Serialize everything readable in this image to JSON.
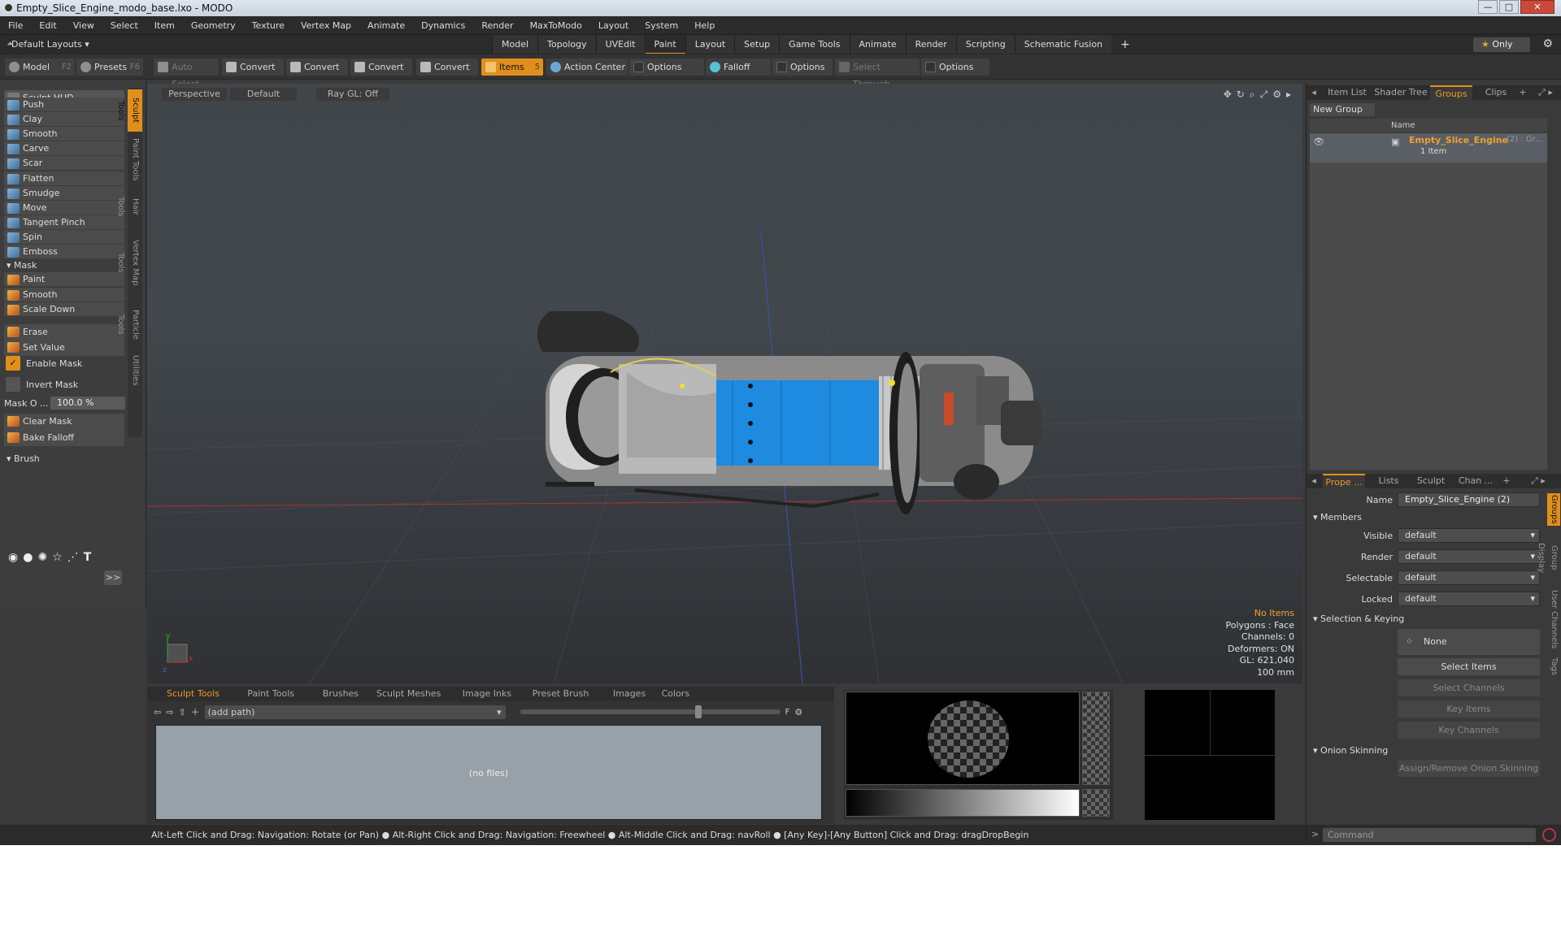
{
  "window": {
    "title": "Empty_Slice_Engine_modo_base.lxo - MODO"
  },
  "menu": [
    "File",
    "Edit",
    "View",
    "Select",
    "Item",
    "Geometry",
    "Texture",
    "Vertex Map",
    "Animate",
    "Dynamics",
    "Render",
    "MaxToModo",
    "Layout",
    "System",
    "Help"
  ],
  "modebar": {
    "layouts": "Default Layouts ▾",
    "tabs": [
      "Model",
      "Topology",
      "UVEdit",
      "Paint",
      "Layout",
      "Setup",
      "Game Tools",
      "Animate",
      "Render",
      "Scripting",
      "Schematic Fusion"
    ],
    "active_tab": "Paint",
    "plus": "+",
    "only": "Only"
  },
  "toolbar": {
    "model": "Model",
    "model_key": "F2",
    "presets": "Presets",
    "presets_key": "F6",
    "auto_select": "Auto Select",
    "convert": "Convert",
    "items": "Items",
    "items_key": "5",
    "action_center": "Action Center",
    "options": "Options",
    "falloff": "Falloff",
    "select_through": "Select Through"
  },
  "left": {
    "hud": "Sculpt HUD",
    "tools": [
      "Push",
      "Clay",
      "Smooth",
      "Carve",
      "Scar",
      "Flatten",
      "Smudge",
      "Move",
      "Tangent Pinch",
      "Spin",
      "Emboss"
    ],
    "mask_section": "Mask",
    "mask_tools": [
      "Paint",
      "Smooth",
      "Scale Down"
    ],
    "erase": "Erase",
    "set_value": "Set Value",
    "enable_mask": "Enable Mask",
    "invert_mask": "Invert Mask",
    "mask_opacity_label": "Mask O ...",
    "mask_opacity_value": "100.0 %",
    "clear_mask": "Clear Mask",
    "bake_falloff": "Bake Falloff",
    "brush_section": "Brush",
    "more": ">>",
    "vtabs": [
      "Sculpt Tools",
      "Paint Tools",
      "Hair Tools",
      "Vertex Map Tools",
      "Particle Tools",
      "Utilities"
    ]
  },
  "viewport": {
    "view": "Perspective",
    "shading": "Default",
    "raygl": "Ray GL: Off",
    "stats": {
      "items": "No Items",
      "polygons": "Polygons : Face",
      "channels": "Channels: 0",
      "deformers": "Deformers: ON",
      "gl": "GL: 621,040",
      "scale": "100 mm"
    }
  },
  "groups_panel": {
    "tabs": [
      "Item List",
      "Shader Tree",
      "Groups",
      "Clips"
    ],
    "active_tab": "Groups",
    "new_group": "New Group",
    "col_name": "Name",
    "group_name": "Empty_Slice_Engine",
    "group_suffix": "(2) : Gr...",
    "group_count": "1 Item"
  },
  "properties": {
    "tabs": [
      "Prope ...",
      "Lists",
      "Sculpt",
      "Chan ..."
    ],
    "name_label": "Name",
    "name_value": "Empty_Slice_Engine (2)",
    "members": "Members",
    "visible": "Visible",
    "render": "Render",
    "selectable": "Selectable",
    "locked": "Locked",
    "default": "default",
    "sel_keying": "Selection & Keying",
    "none": "None",
    "select_items": "Select Items",
    "select_channels": "Select Channels",
    "key_items": "Key Items",
    "key_channels": "Key Channels",
    "onion": "Onion Skinning",
    "assign_onion": "Assign/Remove Onion Skinning",
    "vtabs": [
      "Groups",
      "Group Display",
      "User Channels",
      "Tags"
    ],
    "command": "Command"
  },
  "bottom": {
    "tabs": [
      "Sculpt Tools",
      "Paint Tools",
      "Brushes",
      "Sculpt Meshes",
      "Image Inks",
      "Preset Brush",
      "Images",
      "Colors"
    ],
    "active_tab": "Sculpt Tools",
    "path": "(add path)",
    "no_files": "(no files)"
  },
  "status": "Alt-Left Click and Drag: Navigation: Rotate (or Pan) ● Alt-Right Click and Drag: Navigation: Freewheel ● Alt-Middle Click and Drag: navRoll ● [Any Key]-[Any Button] Click and Drag: dragDropBegin",
  "colors": {
    "accent": "#e08f1c",
    "highlight": "#f0a030",
    "engine_blue": "#1e8be0"
  }
}
